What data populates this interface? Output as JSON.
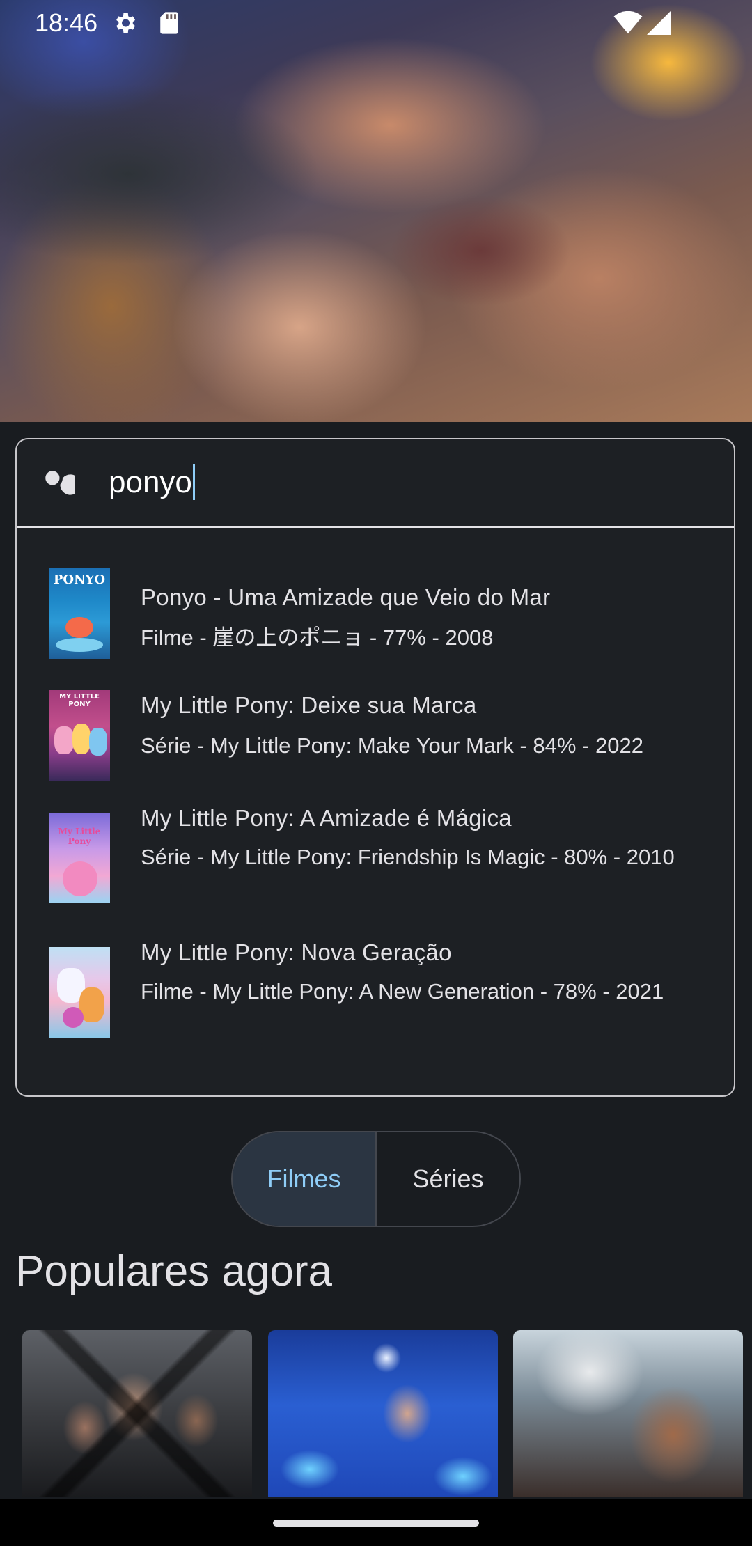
{
  "status_bar": {
    "time": "18:46"
  },
  "search": {
    "query": "ponyo"
  },
  "results": [
    {
      "title": "Ponyo - Uma Amizade que Veio do Mar",
      "subtitle": "Filme - 崖の上のポニョ - 77% - 2008",
      "poster_text": "PONYO"
    },
    {
      "title": "My Little Pony: Deixe sua Marca",
      "subtitle": "Série - My Little Pony: Make Your Mark - 84% - 2022",
      "poster_text": "MY LITTLE PONY"
    },
    {
      "title": "My Little Pony:  A Amizade é Mágica",
      "subtitle": "Série - My Little Pony: Friendship Is Magic - 80% - 2010",
      "poster_text": "My Little Pony"
    },
    {
      "title": "My Little Pony: Nova Geração",
      "subtitle": "Filme - My Little Pony: A New Generation - 78% - 2021",
      "poster_text": ""
    }
  ],
  "segmented": {
    "movies": "Filmes",
    "series": "Séries",
    "selected": "Filmes"
  },
  "section": {
    "title": "Populares agora"
  },
  "colors": {
    "background": "#191c20",
    "accent": "#8fcdf7",
    "selected_segment": "#2b3542"
  },
  "icons": {
    "search": "search-icon",
    "settings": "gear-icon",
    "sd_card": "sd-card-icon",
    "wifi": "wifi-icon",
    "signal": "signal-icon"
  }
}
